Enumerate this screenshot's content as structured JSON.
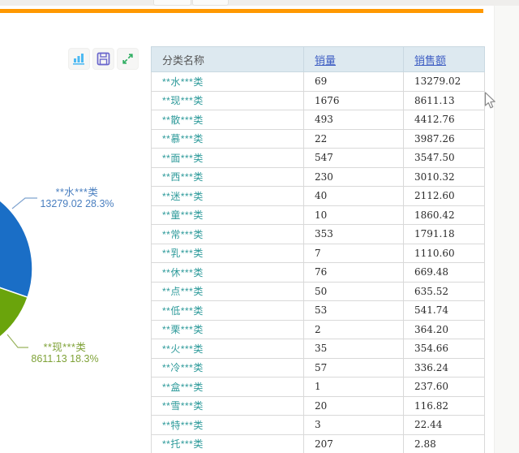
{
  "page": {
    "accent_bar_color": "#ff9800",
    "top_strip_color": "#efeeec"
  },
  "toolbar": {
    "buttons": [
      {
        "icon": "bar-chart-icon",
        "color": "#4cb9f2"
      },
      {
        "icon": "save-icon",
        "color": "#6a66cc"
      },
      {
        "icon": "expand-icon",
        "color": "#2fae62"
      }
    ]
  },
  "chart_data": {
    "type": "pie",
    "title": "",
    "legend_position": "none",
    "labels_visible": true,
    "note_layout": "pie partially clipped by left edge of viewport",
    "series": [
      {
        "name": "**水***类",
        "value": 13279.02,
        "percent": "28.3%",
        "color": "#1a6ec6",
        "label_color": "#4a7fc0"
      },
      {
        "name": "**现***类",
        "value": 8611.13,
        "percent": "18.3%",
        "color": "#6aa40c",
        "label_color": "#7fa238"
      }
    ]
  },
  "pie_labels": {
    "blue_name": "**水***类",
    "blue_value": "13279.02  28.3%",
    "green_name": "**现***类",
    "green_value": "8611.13  18.3%"
  },
  "table": {
    "headers": {
      "category": "分类名称",
      "qty": "销量",
      "amount": "销售额"
    },
    "rows": [
      {
        "name": "**水***类",
        "qty": "69",
        "amount": "13279.02"
      },
      {
        "name": "**现***类",
        "qty": "1676",
        "amount": "8611.13"
      },
      {
        "name": "**散***类",
        "qty": "493",
        "amount": "4412.76"
      },
      {
        "name": "**慕***类",
        "qty": "22",
        "amount": "3987.26"
      },
      {
        "name": "**面***类",
        "qty": "547",
        "amount": "3547.50"
      },
      {
        "name": "**西***类",
        "qty": "230",
        "amount": "3010.32"
      },
      {
        "name": "**迷***类",
        "qty": "40",
        "amount": "2112.60"
      },
      {
        "name": "**童***类",
        "qty": "10",
        "amount": "1860.42"
      },
      {
        "name": "**常***类",
        "qty": "353",
        "amount": "1791.18"
      },
      {
        "name": "**乳***类",
        "qty": "7",
        "amount": "1110.60"
      },
      {
        "name": "**休***类",
        "qty": "76",
        "amount": "669.48"
      },
      {
        "name": "**点***类",
        "qty": "50",
        "amount": "635.52"
      },
      {
        "name": "**低***类",
        "qty": "53",
        "amount": "541.74"
      },
      {
        "name": "**栗***类",
        "qty": "2",
        "amount": "364.20"
      },
      {
        "name": "**火***类",
        "qty": "35",
        "amount": "354.66"
      },
      {
        "name": "**冷***类",
        "qty": "57",
        "amount": "336.24"
      },
      {
        "name": "**盒***类",
        "qty": "1",
        "amount": "237.60"
      },
      {
        "name": "**雪***类",
        "qty": "20",
        "amount": "116.82"
      },
      {
        "name": "**特***类",
        "qty": "3",
        "amount": "22.44"
      },
      {
        "name": "**托***类",
        "qty": "207",
        "amount": "2.88"
      }
    ]
  }
}
